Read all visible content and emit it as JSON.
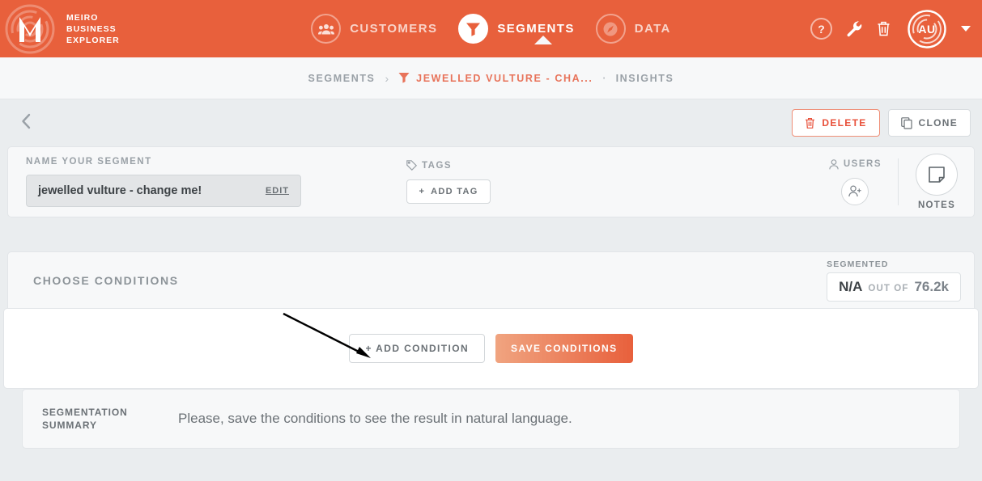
{
  "brand": {
    "line1": "MEIRO",
    "line2": "BUSINESS",
    "line3": "EXPLORER",
    "logo_icon": "meiro-maze-logo"
  },
  "header": {
    "nav": [
      {
        "label": "CUSTOMERS",
        "icon": "customers-group-icon",
        "active": false
      },
      {
        "label": "SEGMENTS",
        "icon": "segments-funnel-icon",
        "active": true
      },
      {
        "label": "DATA",
        "icon": "data-gauge-icon",
        "active": false
      }
    ],
    "help_label": "?",
    "icons": [
      "help-icon",
      "wrench-icon",
      "trash-icon"
    ],
    "avatar_initials": "AU",
    "accent_color": "#e8603c"
  },
  "breadcrumb": {
    "root": "SEGMENTS",
    "separator": "›",
    "segment": "JEWELLED VULTURE - CHA...",
    "segment_icon": "funnel-icon",
    "dot": "·",
    "current": "INSIGHTS"
  },
  "actionbar": {
    "back_icon": "back-chevron-icon",
    "delete_label": "DELETE",
    "delete_icon": "trash-icon",
    "clone_label": "CLONE",
    "clone_icon": "copy-icon"
  },
  "name_card": {
    "name_label": "NAME YOUR SEGMENT",
    "name_value": "jewelled vulture - change me!",
    "name_placeholder": "Name your segment",
    "edit_label": "EDIT",
    "tags_label": "TAGS",
    "tags_icon": "tag-icon",
    "add_tag_label": "ADD TAG",
    "users_label": "USERS",
    "users_icon": "user-icon",
    "add_user_icon": "add-user-icon",
    "notes_label": "NOTES",
    "notes_icon": "note-icon"
  },
  "conditions": {
    "title": "CHOOSE CONDITIONS",
    "segmented_label": "SEGMENTED",
    "segmented_value": "N/A",
    "out_of_label": "OUT OF",
    "total_value": "76.2k",
    "add_condition_label": "+ ADD CONDITION",
    "save_conditions_label": "SAVE CONDITIONS"
  },
  "summary": {
    "label_line1": "SEGMENTATION",
    "label_line2": "SUMMARY",
    "text": "Please, save the conditions to see the result in natural language."
  }
}
